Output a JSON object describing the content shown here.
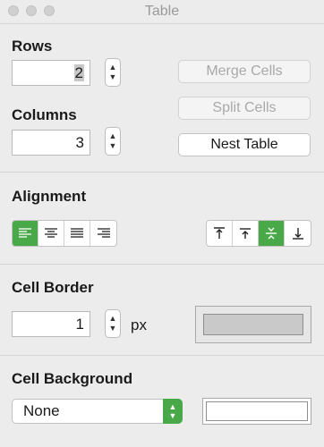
{
  "window": {
    "title": "Table"
  },
  "rows": {
    "label": "Rows",
    "value": "2"
  },
  "columns": {
    "label": "Columns",
    "value": "3"
  },
  "table_actions": {
    "merge_label": "Merge Cells",
    "split_label": "Split Cells",
    "nest_label": "Nest Table"
  },
  "alignment": {
    "label": "Alignment",
    "horizontal": [
      {
        "icon": "align-left-icon",
        "active": true
      },
      {
        "icon": "align-center-icon",
        "active": false
      },
      {
        "icon": "align-justify-icon",
        "active": false
      },
      {
        "icon": "align-right-icon",
        "active": false
      }
    ],
    "vertical": [
      {
        "icon": "align-top-icon",
        "active": false
      },
      {
        "icon": "align-top-baseline-icon",
        "active": false
      },
      {
        "icon": "align-middle-icon",
        "active": true
      },
      {
        "icon": "align-bottom-icon",
        "active": false
      }
    ]
  },
  "cell_border": {
    "label": "Cell Border",
    "value": "1",
    "unit": "px",
    "color": "#c9c9c9"
  },
  "cell_background": {
    "label": "Cell Background",
    "selected": "None",
    "color": "#ffffff"
  },
  "colors": {
    "accent": "#49a948"
  }
}
